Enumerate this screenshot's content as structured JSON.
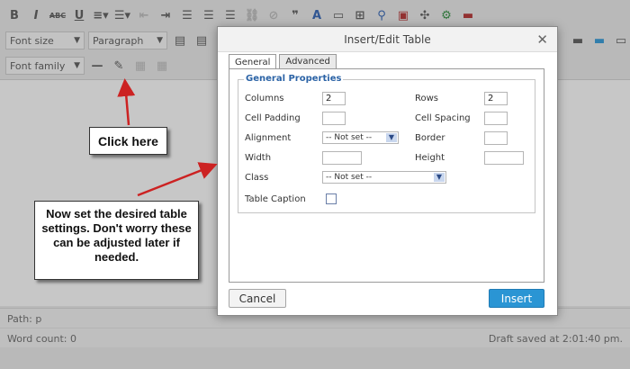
{
  "toolbar": {
    "font_size_label": "Font size",
    "paragraph_label": "Paragraph",
    "font_family_label": "Font family",
    "bold_label": "B",
    "italic_label": "I",
    "strike_label": "ABC",
    "underline_label": "U"
  },
  "status": {
    "path": "Path: p",
    "word_count": "Word count: 0",
    "draft_saved": "Draft saved at 2:01:40 pm."
  },
  "modal": {
    "title": "Insert/Edit Table",
    "close_label": "✕",
    "tabs": [
      "General",
      "Advanced"
    ],
    "legend": "General Properties",
    "fields": {
      "columns_label": "Columns",
      "columns_value": "2",
      "rows_label": "Rows",
      "rows_value": "2",
      "cell_padding_label": "Cell Padding",
      "cell_padding_value": "",
      "cell_spacing_label": "Cell Spacing",
      "cell_spacing_value": "",
      "alignment_label": "Alignment",
      "alignment_value": "-- Not set --",
      "border_label": "Border",
      "border_value": "",
      "width_label": "Width",
      "width_value": "",
      "height_label": "Height",
      "height_value": "",
      "class_label": "Class",
      "class_value": "-- Not set --",
      "caption_label": "Table Caption",
      "caption_checked": false
    },
    "cancel_label": "Cancel",
    "insert_label": "Insert"
  },
  "callouts": {
    "click_here": "Click here",
    "set_settings": "Now set the desired table settings.  Don't worry these can be adjusted later if needed."
  },
  "colors": {
    "accent": "#2a95d4",
    "legend": "#2b63a6",
    "arrow": "#cc2222"
  }
}
